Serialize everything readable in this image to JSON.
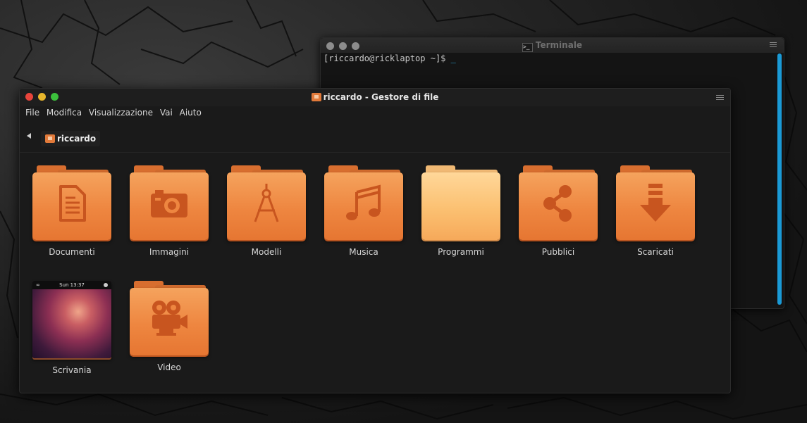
{
  "terminal": {
    "title": "Terminale",
    "prompt": "[riccardo@ricklaptop ~]$ ",
    "cursor": "_"
  },
  "file_manager": {
    "title": "riccardo - Gestore di file",
    "menu": [
      "File",
      "Modifica",
      "Visualizzazione",
      "Vai",
      "Aiuto"
    ],
    "breadcrumb": "riccardo",
    "items": [
      {
        "label": "Documenti",
        "icon": "document-icon"
      },
      {
        "label": "Immagini",
        "icon": "camera-icon"
      },
      {
        "label": "Modelli",
        "icon": "compass-icon"
      },
      {
        "label": "Musica",
        "icon": "music-icon"
      },
      {
        "label": "Programmi",
        "icon": "folder-icon"
      },
      {
        "label": "Pubblici",
        "icon": "share-icon"
      },
      {
        "label": "Scaricati",
        "icon": "download-icon"
      },
      {
        "label": "Scrivania",
        "icon": "desktop-thumbnail"
      },
      {
        "label": "Video",
        "icon": "video-camera-icon"
      }
    ],
    "desktop_thumb_clock": "Sun 13:37"
  },
  "colors": {
    "folder_orange": "#ee8640",
    "folder_light": "#fbc071",
    "close": "#e8443b",
    "minimize": "#e8b62c",
    "maximize": "#3cc03c",
    "terminal_scrollbar": "#1a9ad6"
  }
}
